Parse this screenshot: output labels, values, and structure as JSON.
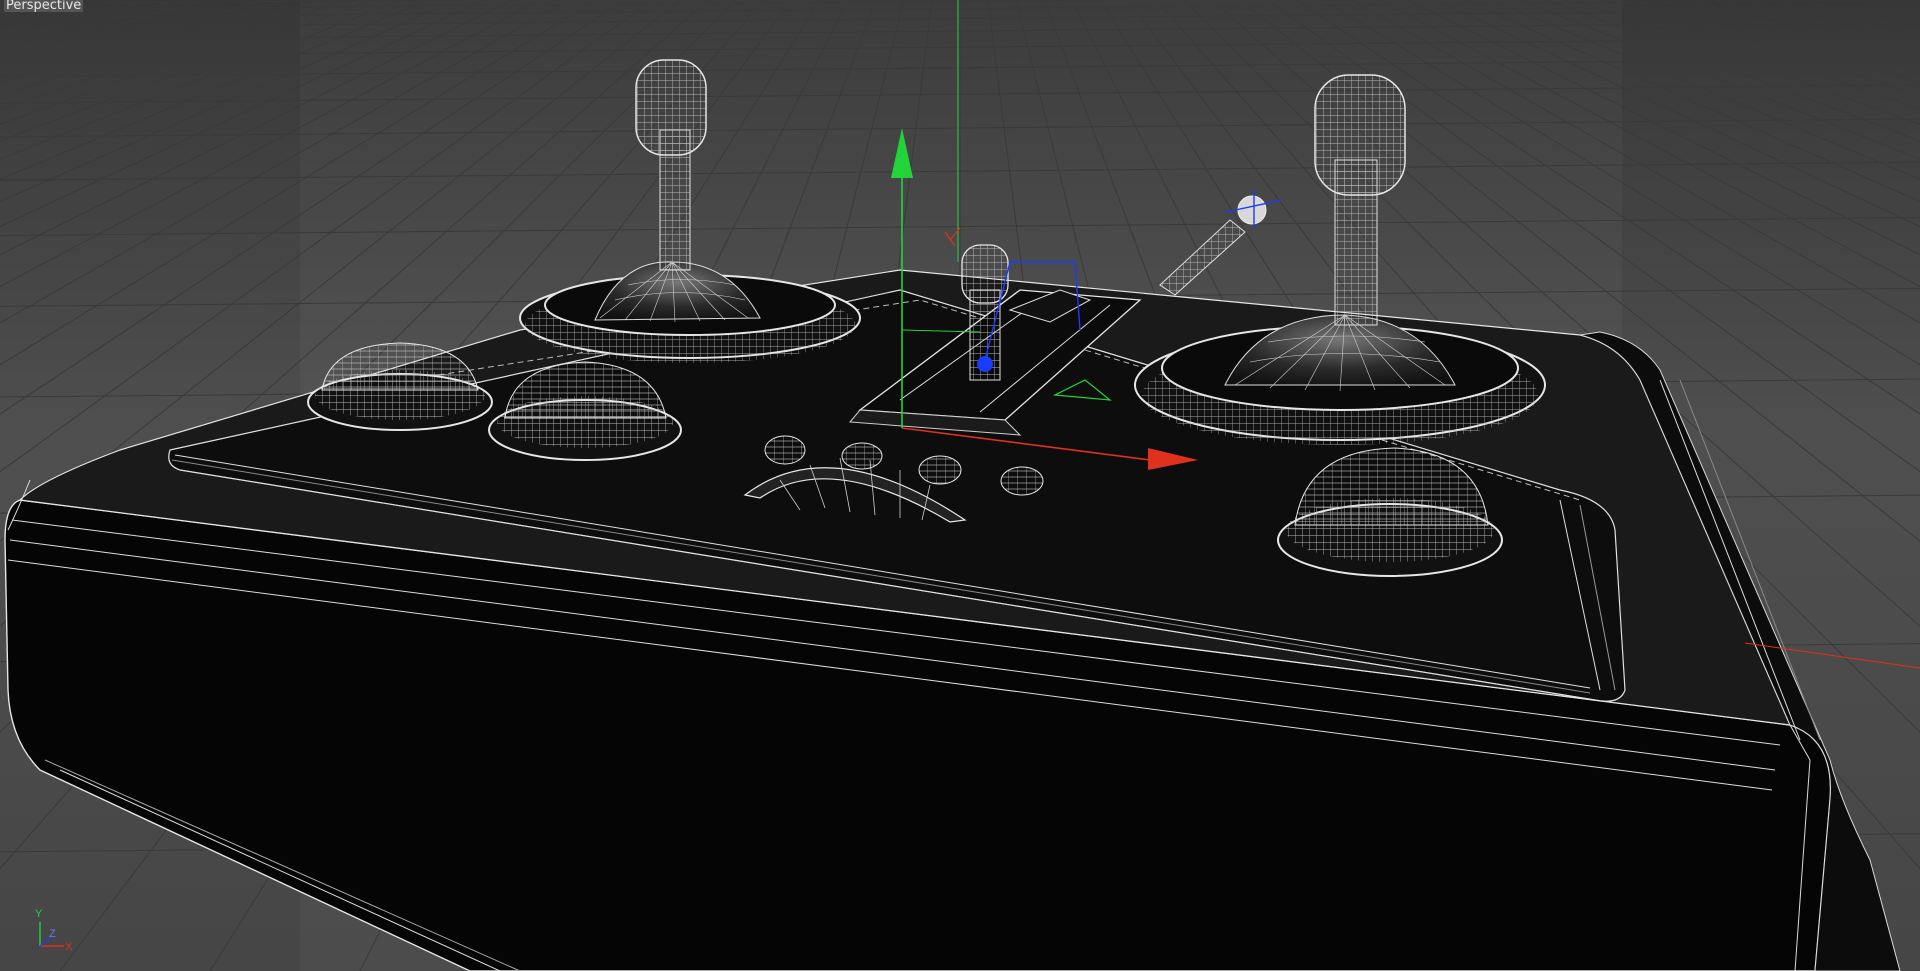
{
  "viewport": {
    "camera_label": "Perspective",
    "background": "#4a4a4a",
    "safe_frame_shade": "#545454"
  },
  "model": {
    "body_color": "#050505",
    "wire_color": "#e6e6e6"
  },
  "gizmo": {
    "x_color": "#e0301e",
    "y_color": "#22d43a",
    "z_color": "#1a3cff"
  },
  "axis_indicator": {
    "y_label": "Y",
    "z_label": "Z",
    "x_label": "X"
  },
  "icons": [
    "move-gizmo-icon",
    "world-axis-icon"
  ]
}
